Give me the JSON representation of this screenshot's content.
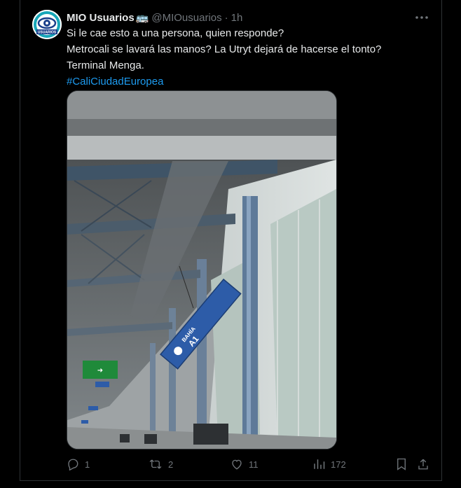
{
  "tweet": {
    "author": {
      "display_name": "MIO Usuarios",
      "emoji": "🚌",
      "handle": "@MIOusuarios",
      "separator": "·",
      "time": "1h",
      "avatar_text": "USUARIOS"
    },
    "lines": [
      "Si le cae esto a una persona, quien responde?",
      "Metrocali se lavará las manos? La Utryt dejará de hacerse el tonto?",
      "Terminal Menga."
    ],
    "hashtag": "#CaliCiudadEuropea",
    "photo": {
      "signs": {
        "bahia_word": "BAHÍA",
        "bahia_code": "A1"
      }
    },
    "actions": {
      "replies": "1",
      "reposts": "2",
      "likes": "11",
      "views": "172"
    }
  },
  "colors": {
    "background": "#000000",
    "text": "#e7e9ea",
    "muted": "#71767b",
    "link": "#1d9bf0",
    "border": "#2f3336"
  }
}
